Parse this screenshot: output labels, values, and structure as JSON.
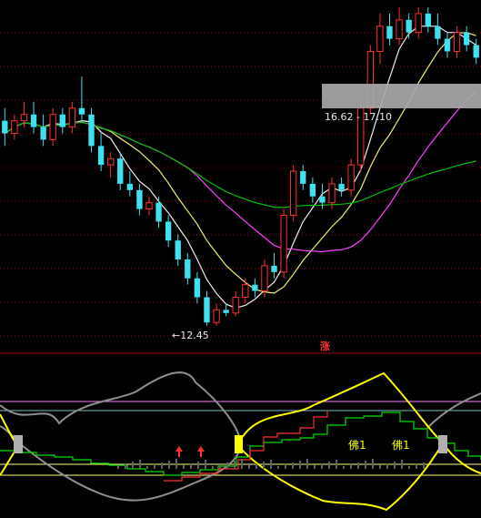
{
  "colors": {
    "bg": "#000000",
    "up": "#ff3030",
    "down": "#40e0f0",
    "ma_white": "#f0f0f0",
    "ma_yellow": "#f0f070",
    "ma_magenta": "#ff40ff",
    "ma_green": "#00c000",
    "grid": "#a00000",
    "ind_grey": "#909090",
    "ind_yellow": "#ffff00",
    "ind_green": "#00e000",
    "ind_red": "#ff3030",
    "ind_line_pink": "#ff80ff",
    "ind_line_cyan": "#80c0c0",
    "ind_line_yellow": "#ffff80"
  },
  "chart_data": [
    {
      "type": "candlestick",
      "title": "",
      "annotations": {
        "low_label": "←12.45",
        "range_label": "16.62 - 17.10",
        "marker_label": "涨"
      },
      "candles": [
        [
          15.7,
          15.9,
          15.3,
          15.5
        ],
        [
          15.5,
          15.8,
          15.4,
          15.7
        ],
        [
          15.7,
          16.0,
          15.6,
          15.8
        ],
        [
          15.8,
          16.0,
          15.5,
          15.6
        ],
        [
          15.6,
          15.8,
          15.3,
          15.4
        ],
        [
          15.4,
          15.9,
          15.3,
          15.8
        ],
        [
          15.8,
          15.9,
          15.5,
          15.6
        ],
        [
          15.6,
          16.0,
          15.5,
          15.9
        ],
        [
          15.9,
          16.4,
          15.7,
          15.8
        ],
        [
          15.8,
          15.9,
          15.2,
          15.3
        ],
        [
          15.3,
          15.5,
          14.9,
          15.0
        ],
        [
          15.0,
          15.2,
          14.8,
          15.1
        ],
        [
          15.1,
          15.2,
          14.6,
          14.7
        ],
        [
          14.7,
          14.9,
          14.5,
          14.6
        ],
        [
          14.6,
          14.7,
          14.2,
          14.3
        ],
        [
          14.3,
          14.5,
          14.2,
          14.4
        ],
        [
          14.4,
          14.5,
          14.0,
          14.1
        ],
        [
          14.1,
          14.2,
          13.7,
          13.8
        ],
        [
          13.8,
          13.9,
          13.4,
          13.5
        ],
        [
          13.5,
          13.6,
          13.1,
          13.2
        ],
        [
          13.2,
          13.3,
          12.8,
          12.9
        ],
        [
          12.9,
          13.0,
          12.45,
          12.5
        ],
        [
          12.5,
          12.8,
          12.45,
          12.7
        ],
        [
          12.7,
          12.8,
          12.6,
          12.65
        ],
        [
          12.65,
          13.0,
          12.6,
          12.9
        ],
        [
          12.9,
          13.2,
          12.8,
          13.1
        ],
        [
          13.1,
          13.2,
          12.9,
          13.0
        ],
        [
          13.0,
          13.5,
          12.9,
          13.4
        ],
        [
          13.4,
          13.6,
          13.2,
          13.3
        ],
        [
          13.3,
          14.3,
          13.2,
          14.2
        ],
        [
          14.2,
          15.0,
          14.1,
          14.9
        ],
        [
          14.9,
          15.0,
          14.6,
          14.7
        ],
        [
          14.7,
          14.8,
          14.4,
          14.5
        ],
        [
          14.5,
          14.7,
          14.3,
          14.4
        ],
        [
          14.4,
          14.8,
          14.3,
          14.7
        ],
        [
          14.7,
          14.8,
          14.5,
          14.6
        ],
        [
          14.6,
          15.1,
          14.5,
          15.0
        ],
        [
          15.0,
          16.0,
          14.9,
          15.9
        ],
        [
          15.9,
          16.9,
          15.8,
          16.8
        ],
        [
          16.8,
          17.4,
          16.6,
          17.2
        ],
        [
          17.2,
          17.4,
          16.9,
          17.0
        ],
        [
          17.0,
          17.5,
          16.9,
          17.3
        ],
        [
          17.3,
          17.4,
          17.0,
          17.1
        ],
        [
          17.1,
          17.5,
          17.0,
          17.4
        ],
        [
          17.4,
          17.5,
          17.1,
          17.2
        ],
        [
          17.2,
          17.4,
          16.9,
          17.0
        ],
        [
          17.0,
          17.1,
          16.7,
          16.8
        ],
        [
          16.8,
          17.2,
          16.7,
          17.1
        ],
        [
          17.1,
          17.2,
          16.8,
          16.9
        ],
        [
          16.9,
          17.0,
          16.6,
          16.7
        ]
      ],
      "ylim": [
        12.2,
        17.5
      ]
    },
    {
      "type": "line",
      "title": "",
      "labels": [
        "佛1",
        "佛1"
      ],
      "series": []
    }
  ]
}
